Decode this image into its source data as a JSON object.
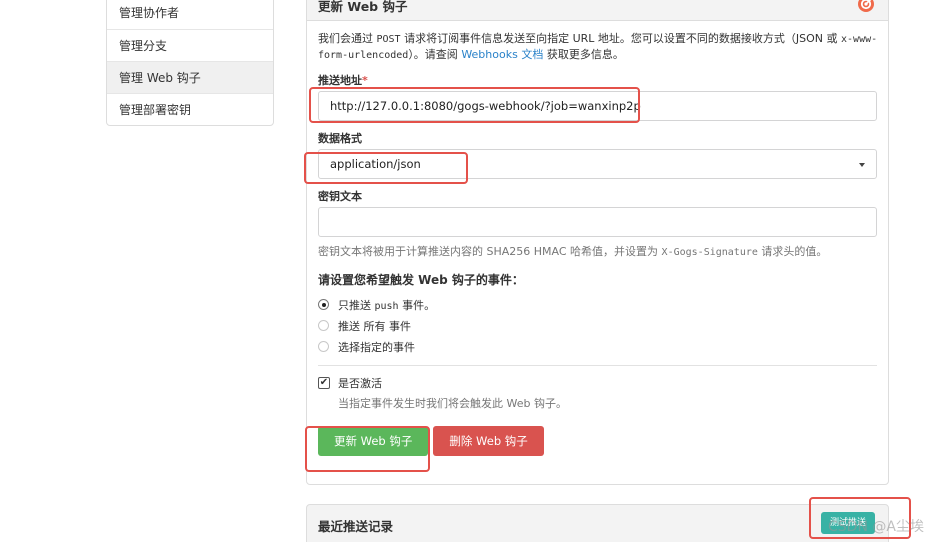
{
  "sidebar": {
    "items": [
      {
        "label": "管理协作者"
      },
      {
        "label": "管理分支"
      },
      {
        "label": "管理 Web 钩子"
      },
      {
        "label": "管理部署密钥"
      }
    ]
  },
  "webhook_form": {
    "title": "更新 Web 钩子",
    "description_part1": "我们会通过 ",
    "description_post": "POST",
    "description_part2": " 请求将订阅事件信息发送至向指定 URL 地址。您可以设置不同的数据接收方式（JSON 或 ",
    "description_mono2": "x-www-form-urlencoded",
    "description_part3": "）。请查阅 ",
    "description_link": "Webhooks 文档",
    "description_part4": " 获取更多信息。",
    "payload_url_label": "推送地址",
    "required_mark": "*",
    "payload_url_value": "http://127.0.0.1:8080/gogs-webhook/?job=wanxinp2p",
    "content_type_label": "数据格式",
    "content_type_value": "application/json",
    "secret_label": "密钥文本",
    "secret_value": "",
    "secret_hint_part1": "密钥文本将被用于计算推送内容的 SHA256 HMAC 哈希值，并设置为 ",
    "secret_hint_mono": "X-Gogs-Signature",
    "secret_hint_part2": " 请求头的值。",
    "events_title": "请设置您希望触发 Web 钩子的事件：",
    "event_options": [
      {
        "prefix": "只推送 ",
        "mono": "push",
        "suffix": " 事件。",
        "checked": true
      },
      {
        "prefix": "推送 所有 事件",
        "mono": "",
        "suffix": "",
        "checked": false
      },
      {
        "prefix": "选择指定的事件",
        "mono": "",
        "suffix": "",
        "checked": false
      }
    ],
    "active_label": "是否激活",
    "active_checked": true,
    "active_hint": "当指定事件发生时我们将会触发此 Web 钩子。",
    "update_button": "更新 Web 钩子",
    "delete_button": "删除 Web 钩子"
  },
  "recent_deliveries": {
    "title": "最近推送记录",
    "test_button": "测试推送"
  },
  "watermark": "CSDN @A尘埃",
  "colors": {
    "highlight": "#e4514a",
    "primary_green": "#5bb75b",
    "danger_red": "#d9534f",
    "test_teal": "#38b2a5",
    "link": "#2a82c9"
  }
}
